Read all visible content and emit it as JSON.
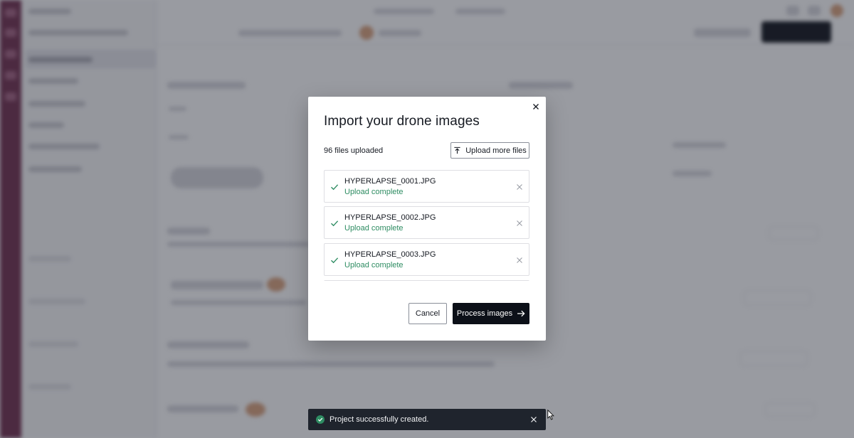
{
  "modal": {
    "title": "Import your drone images",
    "files_count_text": "96 files uploaded",
    "upload_more_label": "Upload more files",
    "close_icon": "close-icon",
    "files": [
      {
        "name": "HYPERLAPSE_0001.JPG",
        "status": "Upload complete"
      },
      {
        "name": "HYPERLAPSE_0002.JPG",
        "status": "Upload complete"
      },
      {
        "name": "HYPERLAPSE_0003.JPG",
        "status": "Upload complete"
      }
    ],
    "cancel_label": "Cancel",
    "process_label": "Process images"
  },
  "toast": {
    "message": "Project successfully created.",
    "status_color": "#2e8c62"
  },
  "colors": {
    "primary_button": "#0c1018",
    "success_text": "#2e8c62",
    "overlay": "#262a38",
    "toast_bg": "#1f242d"
  }
}
